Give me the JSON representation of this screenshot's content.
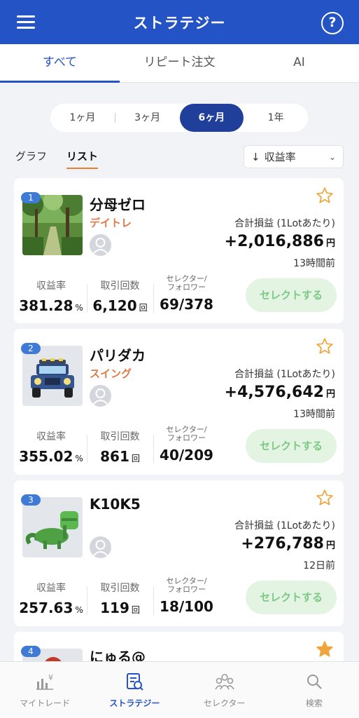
{
  "header": {
    "title": "ストラテジー",
    "help": "?"
  },
  "tabs": [
    {
      "label": "すべて"
    },
    {
      "label": "リピート注文"
    },
    {
      "label": "AI"
    }
  ],
  "periods": [
    {
      "label": "1ヶ月"
    },
    {
      "label": "3ヶ月"
    },
    {
      "label": "6ヶ月"
    },
    {
      "label": "1年"
    }
  ],
  "view": {
    "graph": "グラフ",
    "list": "リスト"
  },
  "sort": {
    "label": "収益率"
  },
  "cards": [
    {
      "rank": "1",
      "name": "分母ゼロ",
      "style": "デイトレ",
      "pl_label": "合計損益 (1Lotあたり)",
      "pl_value": "+2,016,886",
      "pl_unit": "円",
      "updated": "13時間前",
      "yield_label": "収益率",
      "yield_value": "381.28",
      "yield_unit": "%",
      "trades_label": "取引回数",
      "trades_value": "6,120",
      "trades_unit": "回",
      "selector_label_1": "セレクター/",
      "selector_label_2": "フォロワー",
      "selector_value": "69/378",
      "select_button": "セレクトする",
      "favorite": false
    },
    {
      "rank": "2",
      "name": "パリダカ",
      "style": "スイング",
      "pl_label": "合計損益 (1Lotあたり)",
      "pl_value": "+4,576,642",
      "pl_unit": "円",
      "updated": "13時間前",
      "yield_label": "収益率",
      "yield_value": "355.02",
      "yield_unit": "%",
      "trades_label": "取引回数",
      "trades_value": "861",
      "trades_unit": "回",
      "selector_label_1": "セレクター/",
      "selector_label_2": "フォロワー",
      "selector_value": "40/209",
      "select_button": "セレクトする",
      "favorite": false
    },
    {
      "rank": "3",
      "name": "K10K5",
      "style": "",
      "pl_label": "合計損益 (1Lotあたり)",
      "pl_value": "+276,788",
      "pl_unit": "円",
      "updated": "12日前",
      "yield_label": "収益率",
      "yield_value": "257.63",
      "yield_unit": "%",
      "trades_label": "取引回数",
      "trades_value": "119",
      "trades_unit": "回",
      "selector_label_1": "セレクター/",
      "selector_label_2": "フォロワー",
      "selector_value": "18/100",
      "select_button": "セレクトする",
      "favorite": false
    },
    {
      "rank": "4",
      "name": "にゅる@",
      "favorite": true
    }
  ],
  "bottom_nav": [
    {
      "label": "マイトレード",
      "icon": "chart-yen-icon"
    },
    {
      "label": "ストラテジー",
      "icon": "strategy-icon"
    },
    {
      "label": "セレクター",
      "icon": "people-icon"
    },
    {
      "label": "検索",
      "icon": "search-icon"
    }
  ],
  "colors": {
    "primary": "#2453c5",
    "accent": "#e8812d",
    "style_text": "#e07a4a",
    "select_button_bg": "#e3f4e2",
    "star": "#f0a53a"
  }
}
